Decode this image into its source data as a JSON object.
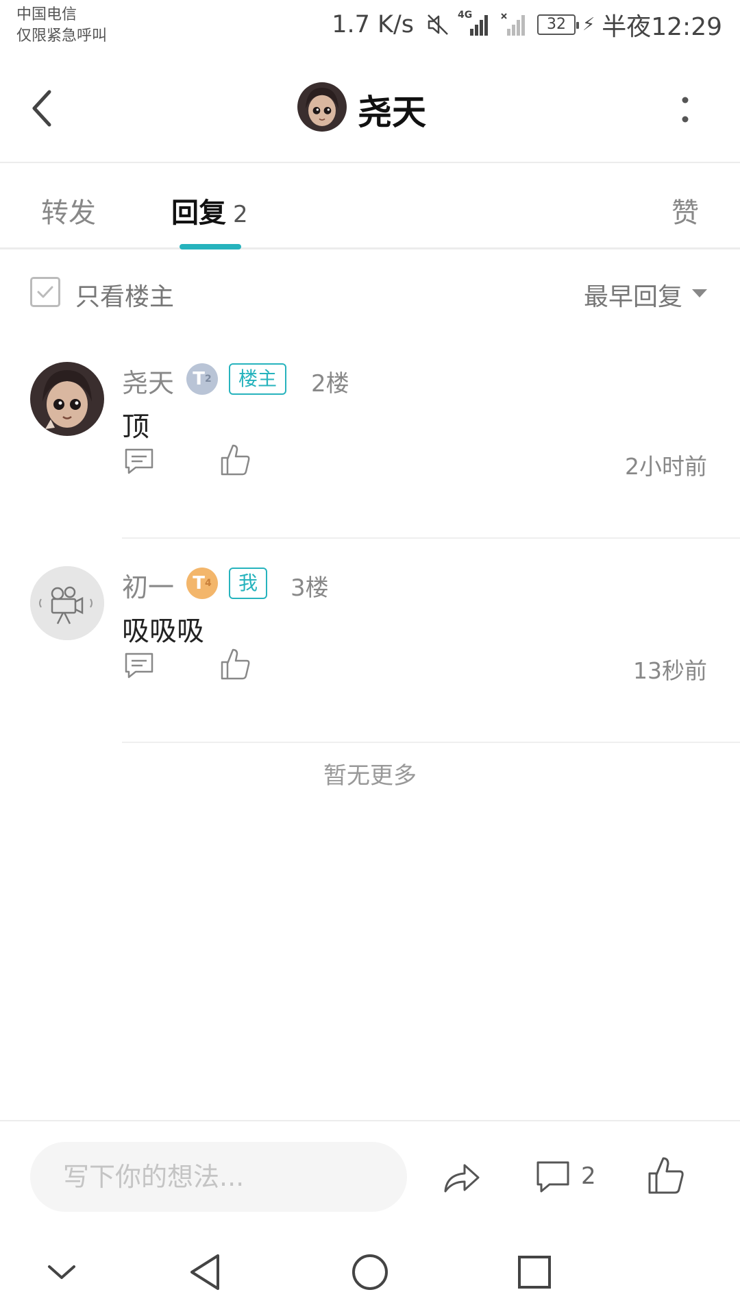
{
  "status_bar": {
    "carrier_line1": "中国电信",
    "carrier_line2": "仅限紧急呼叫",
    "net_speed": "1.7 K/s",
    "network_type": "4G",
    "battery": "32",
    "time": "半夜12:29",
    "icons": [
      "mute-icon",
      "signal-icon",
      "no-signal-icon",
      "battery-icon",
      "charging-icon"
    ]
  },
  "header": {
    "title": "尧天",
    "icons": [
      "back-arrow-icon",
      "more-vertical-icon"
    ]
  },
  "tabs": [
    {
      "label": "转发",
      "active": false
    },
    {
      "label": "回复",
      "count": "2",
      "active": true
    },
    {
      "label": "赞",
      "active": false
    }
  ],
  "filter": {
    "only_op_label": "只看楼主",
    "sort_label": "最早回复"
  },
  "replies": [
    {
      "name": "尧天",
      "level": "T",
      "level_num": "2",
      "tag": "楼主",
      "floor": "2楼",
      "content": "顶",
      "time": "2小时前"
    },
    {
      "name": "初一",
      "level": "T",
      "level_num": "4",
      "tag": "我",
      "floor": "3楼",
      "content": "吸吸吸",
      "time": "13秒前"
    }
  ],
  "no_more": "暂无更多",
  "bottom_bar": {
    "placeholder": "写下你的想法...",
    "comment_count": "2"
  },
  "colors": {
    "accent": "#26b3bd",
    "level2": "#b9c4d6",
    "level4": "#f3b66b"
  }
}
